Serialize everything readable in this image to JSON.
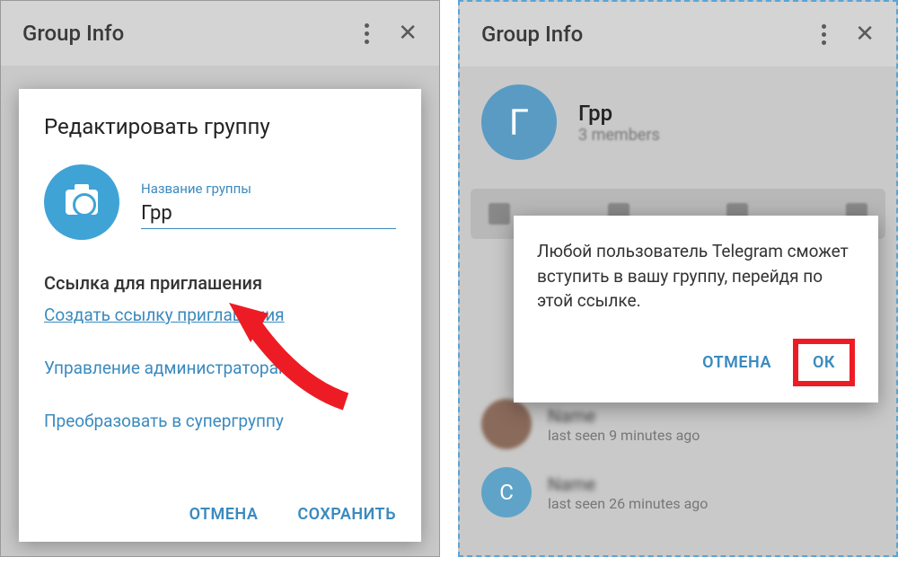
{
  "left": {
    "header_title": "Group Info",
    "dialog_title": "Редактировать группу",
    "field_label": "Название группы",
    "field_value": "Грр",
    "invite_title": "Ссылка для приглашения",
    "create_link": "Создать ссылку приглашения",
    "manage_admins": "Управление администраторам",
    "convert_super": "Преобразовать в супергруппу",
    "cancel": "ОТМЕНА",
    "save": "СОХРАНИТЬ"
  },
  "right": {
    "header_title": "Group Info",
    "group_name": "Грр",
    "group_members": "3 members",
    "avatar_letter": "Г",
    "dialog_text": "Любой пользователь Telegram сможет вступить в вашу группу, перейдя по этой ссылке.",
    "cancel": "ОТМЕНА",
    "ok": "ОК",
    "members": [
      {
        "initial": "",
        "status": "last seen 9 minutes ago"
      },
      {
        "initial": "С",
        "status": "last seen 26 minutes ago"
      }
    ]
  }
}
